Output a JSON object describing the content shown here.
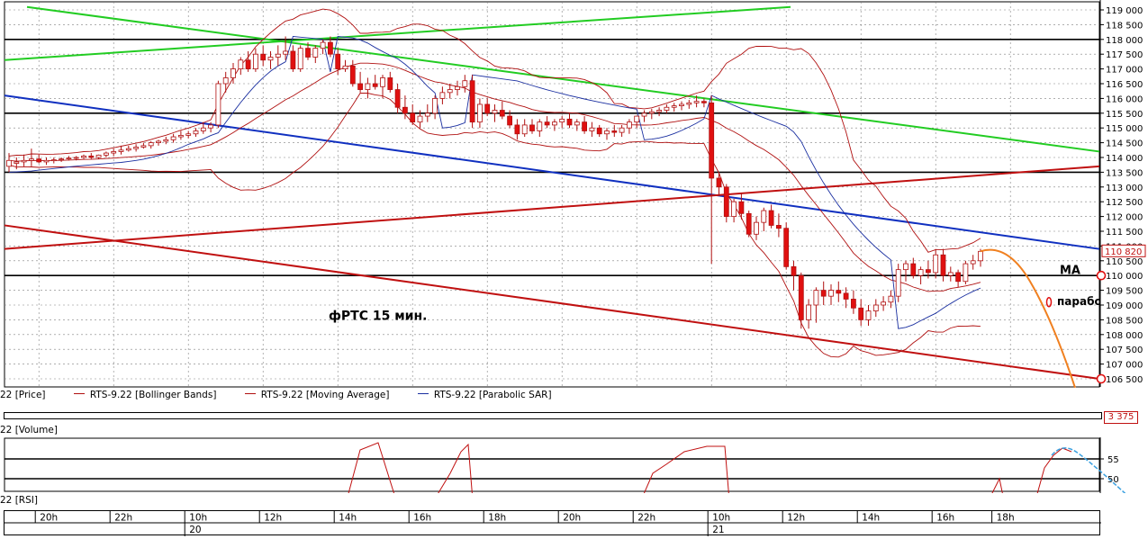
{
  "chart_data": {
    "type": "candlestick",
    "symbol": "RTS-9.22",
    "price_axis": {
      "min": 106500,
      "max": 119100,
      "ticks": [
        119000,
        118500,
        118000,
        117500,
        117000,
        116500,
        116000,
        115500,
        115000,
        114500,
        114000,
        113500,
        113000,
        112500,
        112000,
        111500,
        111000,
        110500,
        110000,
        109500,
        109000,
        108500,
        108000,
        107500,
        107000,
        106500
      ]
    },
    "price_tick_labels": [
      "119 000",
      "118 500",
      "118 000",
      "117 500",
      "117 000",
      "116 500",
      "116 000",
      "115 500",
      "115 000",
      "114 500",
      "114 000",
      "113 500",
      "113 000",
      "112 500",
      "112 000",
      "111 500",
      "111 000",
      "110 500",
      "110 000",
      "109 500",
      "109 000",
      "108 500",
      "108 000",
      "107 500",
      "107 000",
      "106 500"
    ],
    "last_price_label": "110 820",
    "annotation_chart": "фРТС   15 мин.",
    "annotation_ma": "MA",
    "annotation_sar": "параболик",
    "horizontal_levels": [
      118000,
      115500,
      113500,
      110000
    ],
    "candles": [
      {
        "o": 113700,
        "h": 114150,
        "l": 113500,
        "c": 113900
      },
      {
        "o": 113800,
        "h": 114000,
        "l": 113600,
        "c": 113850
      },
      {
        "o": 113850,
        "h": 114100,
        "l": 113700,
        "c": 113900
      },
      {
        "o": 113900,
        "h": 114300,
        "l": 113700,
        "c": 113950
      },
      {
        "o": 113950,
        "h": 114100,
        "l": 113800,
        "c": 113850
      },
      {
        "o": 113850,
        "h": 114000,
        "l": 113750,
        "c": 113900
      },
      {
        "o": 113900,
        "h": 114000,
        "l": 113800,
        "c": 113920
      },
      {
        "o": 113920,
        "h": 114000,
        "l": 113850,
        "c": 113950
      },
      {
        "o": 113950,
        "h": 114050,
        "l": 113900,
        "c": 113980
      },
      {
        "o": 113980,
        "h": 114050,
        "l": 113900,
        "c": 114000
      },
      {
        "o": 114000,
        "h": 114100,
        "l": 113950,
        "c": 114050
      },
      {
        "o": 114050,
        "h": 114150,
        "l": 113950,
        "c": 114000
      },
      {
        "o": 114000,
        "h": 114100,
        "l": 113950,
        "c": 114080
      },
      {
        "o": 114080,
        "h": 114200,
        "l": 114000,
        "c": 114150
      },
      {
        "o": 114150,
        "h": 114300,
        "l": 114050,
        "c": 114200
      },
      {
        "o": 114200,
        "h": 114400,
        "l": 114100,
        "c": 114250
      },
      {
        "o": 114250,
        "h": 114400,
        "l": 114200,
        "c": 114300
      },
      {
        "o": 114300,
        "h": 114450,
        "l": 114200,
        "c": 114350
      },
      {
        "o": 114350,
        "h": 114500,
        "l": 114300,
        "c": 114400
      },
      {
        "o": 114400,
        "h": 114550,
        "l": 114300,
        "c": 114500
      },
      {
        "o": 114500,
        "h": 114600,
        "l": 114400,
        "c": 114550
      },
      {
        "o": 114550,
        "h": 114700,
        "l": 114450,
        "c": 114600
      },
      {
        "o": 114600,
        "h": 114800,
        "l": 114500,
        "c": 114700
      },
      {
        "o": 114700,
        "h": 114900,
        "l": 114600,
        "c": 114750
      },
      {
        "o": 114750,
        "h": 114900,
        "l": 114650,
        "c": 114800
      },
      {
        "o": 114800,
        "h": 115000,
        "l": 114700,
        "c": 114900
      },
      {
        "o": 114900,
        "h": 115200,
        "l": 114800,
        "c": 115000
      },
      {
        "o": 115000,
        "h": 115200,
        "l": 114850,
        "c": 115100
      },
      {
        "o": 115100,
        "h": 116600,
        "l": 115000,
        "c": 116500
      },
      {
        "o": 116500,
        "h": 116900,
        "l": 116200,
        "c": 116700
      },
      {
        "o": 116700,
        "h": 117200,
        "l": 116500,
        "c": 117000
      },
      {
        "o": 117000,
        "h": 117400,
        "l": 116800,
        "c": 117300
      },
      {
        "o": 117300,
        "h": 117600,
        "l": 116900,
        "c": 117000
      },
      {
        "o": 117000,
        "h": 117700,
        "l": 116900,
        "c": 117500
      },
      {
        "o": 117500,
        "h": 117800,
        "l": 117100,
        "c": 117300
      },
      {
        "o": 117300,
        "h": 117600,
        "l": 117000,
        "c": 117400
      },
      {
        "o": 117400,
        "h": 117800,
        "l": 117100,
        "c": 117500
      },
      {
        "o": 117500,
        "h": 118100,
        "l": 117300,
        "c": 117600
      },
      {
        "o": 117600,
        "h": 117800,
        "l": 116900,
        "c": 117000
      },
      {
        "o": 117000,
        "h": 117800,
        "l": 116900,
        "c": 117700
      },
      {
        "o": 117700,
        "h": 117900,
        "l": 117300,
        "c": 117400
      },
      {
        "o": 117400,
        "h": 117800,
        "l": 117200,
        "c": 117700
      },
      {
        "o": 117700,
        "h": 118000,
        "l": 117500,
        "c": 117900
      },
      {
        "o": 117900,
        "h": 118100,
        "l": 117400,
        "c": 117500
      },
      {
        "o": 117500,
        "h": 117700,
        "l": 116800,
        "c": 117000
      },
      {
        "o": 117000,
        "h": 117300,
        "l": 116900,
        "c": 117100
      },
      {
        "o": 117100,
        "h": 117300,
        "l": 116400,
        "c": 116500
      },
      {
        "o": 116500,
        "h": 116900,
        "l": 116200,
        "c": 116300
      },
      {
        "o": 116300,
        "h": 116700,
        "l": 116000,
        "c": 116500
      },
      {
        "o": 116500,
        "h": 116800,
        "l": 116300,
        "c": 116400
      },
      {
        "o": 116400,
        "h": 116800,
        "l": 116000,
        "c": 116700
      },
      {
        "o": 116700,
        "h": 116900,
        "l": 116200,
        "c": 116300
      },
      {
        "o": 116300,
        "h": 116500,
        "l": 115500,
        "c": 115700
      },
      {
        "o": 115700,
        "h": 116100,
        "l": 115300,
        "c": 115500
      },
      {
        "o": 115500,
        "h": 115800,
        "l": 115100,
        "c": 115200
      },
      {
        "o": 115200,
        "h": 115600,
        "l": 115000,
        "c": 115400
      },
      {
        "o": 115400,
        "h": 115800,
        "l": 115200,
        "c": 115500
      },
      {
        "o": 115500,
        "h": 116100,
        "l": 115300,
        "c": 116000
      },
      {
        "o": 116000,
        "h": 116400,
        "l": 115800,
        "c": 116200
      },
      {
        "o": 116200,
        "h": 116500,
        "l": 116000,
        "c": 116300
      },
      {
        "o": 116300,
        "h": 116600,
        "l": 116100,
        "c": 116400
      },
      {
        "o": 116400,
        "h": 116800,
        "l": 116200,
        "c": 116600
      },
      {
        "o": 116600,
        "h": 116800,
        "l": 115000,
        "c": 115200
      },
      {
        "o": 115200,
        "h": 116000,
        "l": 115000,
        "c": 115800
      },
      {
        "o": 115800,
        "h": 116000,
        "l": 115400,
        "c": 115500
      },
      {
        "o": 115500,
        "h": 115800,
        "l": 115200,
        "c": 115600
      },
      {
        "o": 115600,
        "h": 115900,
        "l": 115300,
        "c": 115400
      },
      {
        "o": 115400,
        "h": 115600,
        "l": 115000,
        "c": 115100
      },
      {
        "o": 115100,
        "h": 115300,
        "l": 114600,
        "c": 114800
      },
      {
        "o": 114800,
        "h": 115300,
        "l": 114700,
        "c": 115100
      },
      {
        "o": 115100,
        "h": 115300,
        "l": 114800,
        "c": 114900
      },
      {
        "o": 114900,
        "h": 115300,
        "l": 114700,
        "c": 115200
      },
      {
        "o": 115200,
        "h": 115400,
        "l": 115000,
        "c": 115100
      },
      {
        "o": 115100,
        "h": 115300,
        "l": 114900,
        "c": 115200
      },
      {
        "o": 115200,
        "h": 115400,
        "l": 115000,
        "c": 115300
      },
      {
        "o": 115300,
        "h": 115500,
        "l": 115000,
        "c": 115100
      },
      {
        "o": 115100,
        "h": 115300,
        "l": 114900,
        "c": 115200
      },
      {
        "o": 115200,
        "h": 115400,
        "l": 114800,
        "c": 114900
      },
      {
        "o": 114900,
        "h": 115200,
        "l": 114700,
        "c": 115000
      },
      {
        "o": 115000,
        "h": 115100,
        "l": 114700,
        "c": 114800
      },
      {
        "o": 114800,
        "h": 115000,
        "l": 114600,
        "c": 114900
      },
      {
        "o": 114900,
        "h": 115100,
        "l": 114700,
        "c": 114850
      },
      {
        "o": 114850,
        "h": 115100,
        "l": 114700,
        "c": 115000
      },
      {
        "o": 115000,
        "h": 115300,
        "l": 114800,
        "c": 115200
      },
      {
        "o": 115200,
        "h": 115400,
        "l": 115000,
        "c": 115400
      },
      {
        "o": 115400,
        "h": 115600,
        "l": 115200,
        "c": 115500
      },
      {
        "o": 115500,
        "h": 115650,
        "l": 115300,
        "c": 115550
      },
      {
        "o": 115550,
        "h": 115700,
        "l": 115400,
        "c": 115600
      },
      {
        "o": 115600,
        "h": 115800,
        "l": 115500,
        "c": 115700
      },
      {
        "o": 115700,
        "h": 115850,
        "l": 115550,
        "c": 115750
      },
      {
        "o": 115750,
        "h": 115900,
        "l": 115600,
        "c": 115800
      },
      {
        "o": 115800,
        "h": 115950,
        "l": 115650,
        "c": 115850
      },
      {
        "o": 115850,
        "h": 116100,
        "l": 115700,
        "c": 115900
      },
      {
        "o": 115900,
        "h": 116000,
        "l": 115700,
        "c": 115850
      },
      {
        "o": 115850,
        "h": 116100,
        "l": 110400,
        "c": 113300
      },
      {
        "o": 113300,
        "h": 113500,
        "l": 112700,
        "c": 113000
      },
      {
        "o": 113000,
        "h": 113100,
        "l": 111800,
        "c": 112000
      },
      {
        "o": 112000,
        "h": 112600,
        "l": 111800,
        "c": 112500
      },
      {
        "o": 112500,
        "h": 112800,
        "l": 111900,
        "c": 112100
      },
      {
        "o": 112100,
        "h": 112200,
        "l": 111300,
        "c": 111400
      },
      {
        "o": 111400,
        "h": 112000,
        "l": 111200,
        "c": 111800
      },
      {
        "o": 111800,
        "h": 112300,
        "l": 111500,
        "c": 112200
      },
      {
        "o": 112200,
        "h": 112400,
        "l": 111600,
        "c": 111700
      },
      {
        "o": 111700,
        "h": 112100,
        "l": 111300,
        "c": 111600
      },
      {
        "o": 111600,
        "h": 111800,
        "l": 110200,
        "c": 110300
      },
      {
        "o": 110300,
        "h": 110500,
        "l": 109500,
        "c": 110000
      },
      {
        "o": 110000,
        "h": 110100,
        "l": 108200,
        "c": 108500
      },
      {
        "o": 108500,
        "h": 109200,
        "l": 108200,
        "c": 109000
      },
      {
        "o": 109000,
        "h": 109600,
        "l": 108400,
        "c": 109500
      },
      {
        "o": 109500,
        "h": 109800,
        "l": 109000,
        "c": 109300
      },
      {
        "o": 109300,
        "h": 109700,
        "l": 109000,
        "c": 109500
      },
      {
        "o": 109500,
        "h": 109800,
        "l": 109100,
        "c": 109400
      },
      {
        "o": 109400,
        "h": 109600,
        "l": 108900,
        "c": 109200
      },
      {
        "o": 109200,
        "h": 109500,
        "l": 108700,
        "c": 108900
      },
      {
        "o": 108900,
        "h": 109200,
        "l": 108300,
        "c": 108500
      },
      {
        "o": 108500,
        "h": 109000,
        "l": 108300,
        "c": 108800
      },
      {
        "o": 108800,
        "h": 109200,
        "l": 108600,
        "c": 109000
      },
      {
        "o": 109000,
        "h": 109300,
        "l": 108800,
        "c": 109100
      },
      {
        "o": 109100,
        "h": 109500,
        "l": 108900,
        "c": 109300
      },
      {
        "o": 109300,
        "h": 110400,
        "l": 109100,
        "c": 110200
      },
      {
        "o": 110200,
        "h": 110500,
        "l": 109800,
        "c": 110400
      },
      {
        "o": 110400,
        "h": 110600,
        "l": 109900,
        "c": 110000
      },
      {
        "o": 110000,
        "h": 110300,
        "l": 109700,
        "c": 110200
      },
      {
        "o": 110200,
        "h": 110500,
        "l": 109900,
        "c": 110100
      },
      {
        "o": 110100,
        "h": 110900,
        "l": 109900,
        "c": 110700
      },
      {
        "o": 110700,
        "h": 110900,
        "l": 109800,
        "c": 110000
      },
      {
        "o": 110000,
        "h": 110300,
        "l": 109800,
        "c": 110100
      },
      {
        "o": 110100,
        "h": 110200,
        "l": 109600,
        "c": 109800
      },
      {
        "o": 109800,
        "h": 110500,
        "l": 109700,
        "c": 110400
      },
      {
        "o": 110400,
        "h": 110700,
        "l": 110200,
        "c": 110500
      },
      {
        "o": 110500,
        "h": 110900,
        "l": 110300,
        "c": 110820
      }
    ],
    "time_labels": [
      "20h",
      "22h",
      "10h",
      "12h",
      "14h",
      "16h",
      "18h",
      "20h",
      "22h",
      "10h",
      "12h",
      "14h",
      "16h",
      "18h"
    ],
    "time_label_bar_index": [
      4,
      14,
      24,
      34,
      44,
      54,
      64,
      74,
      84,
      94,
      104,
      114,
      124,
      132
    ],
    "date_labels": [
      {
        "text": "20",
        "bar": 24
      },
      {
        "text": "21",
        "bar": 94
      }
    ],
    "legend": [
      {
        "text": "22 [Price]"
      },
      {
        "text": "RTS-9.22 [Bollinger Bands]",
        "color": "#b01010"
      },
      {
        "text": "RTS-9.22 [Moving Average]",
        "color": "#b01010"
      },
      {
        "text": "RTS-9.22 [Parabolic SAR]",
        "color": "#1a2fa0"
      }
    ],
    "volume_pane": {
      "label": "22 [Volume]",
      "value_label": "3 375"
    },
    "rsi_pane": {
      "label": "22 [RSI]",
      "ticks": [
        55,
        50
      ],
      "tick_labels": [
        "55",
        "50"
      ]
    },
    "colors": {
      "bull": "#ffffff",
      "bear": "#e01010",
      "wick": "#b01010",
      "grid": "#808080",
      "trend_green": "#22cc22",
      "trend_blue": "#1030c0",
      "trend_red": "#c01010",
      "forecast": "#f08020",
      "rsi_forecast": "#3aa0e0",
      "level": "#000000",
      "bb": "#b01010",
      "sar": "#1a2fa0"
    }
  }
}
